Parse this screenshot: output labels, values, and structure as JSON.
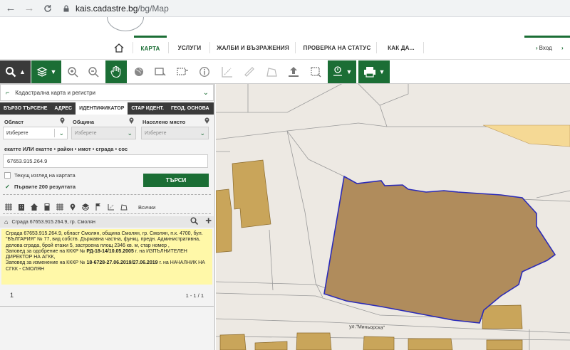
{
  "browser": {
    "url_host": "kais.cadastre.bg",
    "url_path": "/bg/Map",
    "back_icon": "arrow-left-icon",
    "forward_icon": "arrow-right-icon",
    "reload_icon": "reload-icon"
  },
  "nav": {
    "home_icon": "home-icon",
    "items": [
      "КАРТА",
      "УСЛУГИ",
      "ЖАЛБИ И ВЪЗРАЖЕНИЯ",
      "ПРОВЕРКА НА СТАТУС",
      "КАК ДА..."
    ],
    "active_index": 0,
    "login": "Вход",
    "register_arrow": "›"
  },
  "toolbar": {
    "tools": [
      "search-icon",
      "layers-icon",
      "zoom-in-icon",
      "zoom-out-icon",
      "pan-hand-icon",
      "globe-icon",
      "select-rect-icon",
      "select-area-icon",
      "info-icon",
      "measure-icon",
      "ruler-icon",
      "polygon-icon",
      "upload-icon",
      "crop-icon",
      "pin-settings-icon",
      "print-icon"
    ]
  },
  "sidebar": {
    "layer_label": "Кадастрална карта и регистри",
    "tabs": [
      "БЪРЗО ТЪРСЕНЕ",
      "АДРЕС",
      "ИДЕНТИФИКАТОР",
      "СТАР ИДЕНТ.",
      "ГЕОД. ОСНОВА"
    ],
    "active_tab": 2,
    "oblast_label": "Област",
    "obshtina_label": "Община",
    "naseleno_label": "Населено място",
    "oblast_value": "Изберете",
    "obshtina_value": "Изберете",
    "naseleno_value": "Изберете",
    "ekatte_label": "екатте ИЛИ екатте • район • имот • сграда • сос",
    "ekatte_value": "67653.915.264.9",
    "current_view_label": "Текущ изглед на картата",
    "first200_label": "Първите 200 резултата",
    "first200_checked": true,
    "search_button": "ТЪРСИ",
    "all_label": "Всички",
    "result_title": "Сграда 67653.915.264.9, гр. Смолян",
    "info": {
      "line1": "Сграда 67653.915.264.9, област Смолян, община Смолян, гр. Смолян, п.к. 4700, бул. \"БЪЛГАРИЯ\" № 77, вид собств. Държавна частна, функц. предн. Административна, делова сграда, брой етажи 5, застроена площ 2346 кв. м, стар номер ,",
      "order1_prefix": "Заповед за одобрение на КККР № ",
      "order1_bold": "РД-18-14/10.05.2005",
      "order1_suffix": " г. на ИЗПЪЛНИТЕЛЕН ДИРЕКТОР НА АГКК,",
      "order2_prefix": "Заповед за изменение на КККР № ",
      "order2_bold": "18-6728-27.06.2019/27.06.2019",
      "order2_suffix": " г. на НАЧАЛНИК НА СГКК - СМОЛЯН"
    },
    "page_number": "1",
    "page_range": "1 - 1 / 1"
  },
  "map": {
    "street_label": "ул.\"Миньорска\"",
    "colors": {
      "background": "#ede9e3",
      "building_fill": "#c9a55a",
      "selected_fill": "#b08c5c",
      "selected_border": "#2b2bb8",
      "accent_green": "#1b6e35"
    }
  }
}
